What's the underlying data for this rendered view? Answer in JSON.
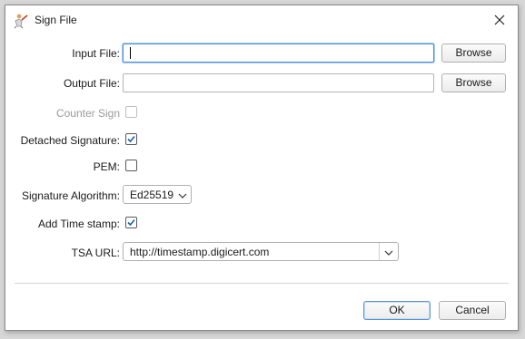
{
  "dialog": {
    "title": "Sign File",
    "icon": "signing-person-icon",
    "close_icon": "close-icon"
  },
  "form": {
    "input_file": {
      "label": "Input File:",
      "value": "",
      "browse_label": "Browse"
    },
    "output_file": {
      "label": "Output File:",
      "value": "",
      "browse_label": "Browse"
    },
    "counter_sign": {
      "label": "Counter Sign",
      "checked": false,
      "enabled": false
    },
    "detached_signature": {
      "label": "Detached Signature:",
      "checked": true
    },
    "pem": {
      "label": "PEM:",
      "checked": false
    },
    "signature_algorithm": {
      "label": "Signature Algorithm:",
      "selected": "Ed25519"
    },
    "add_time_stamp": {
      "label": "Add Time stamp:",
      "checked": true
    },
    "tsa_url": {
      "label": "TSA URL:",
      "value": "http://timestamp.digicert.com"
    }
  },
  "footer": {
    "ok_label": "OK",
    "cancel_label": "Cancel"
  },
  "colors": {
    "accent": "#4a90d9",
    "check": "#1f5fa8"
  }
}
